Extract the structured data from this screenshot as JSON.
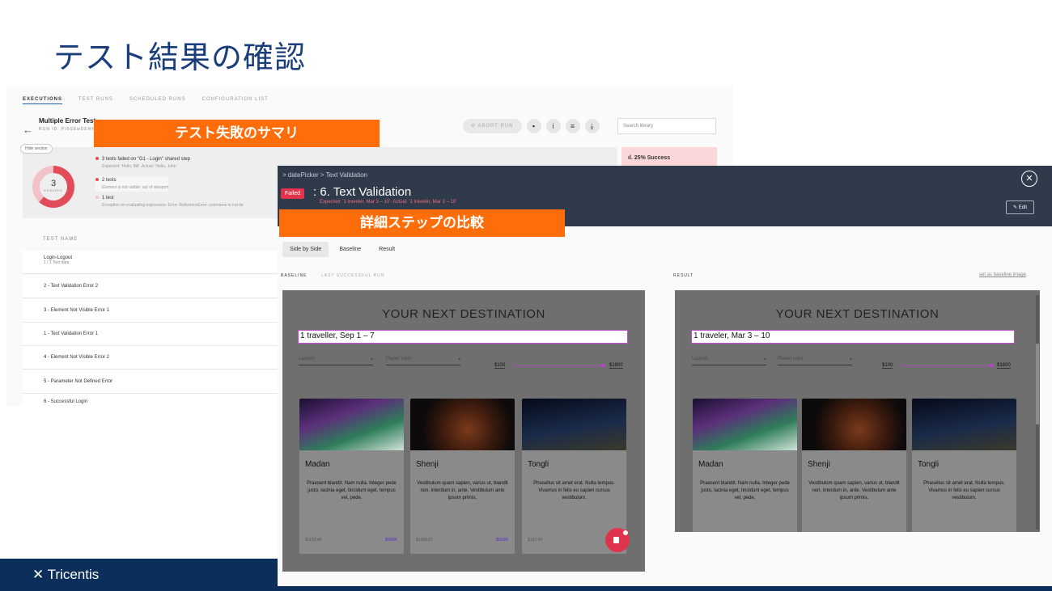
{
  "slide": {
    "title": "テスト結果の確認",
    "footer_logo": "✕ Tricentis",
    "label_summary": "テスト失敗のサマリ",
    "label_steps": "詳細ステップの比較"
  },
  "app": {
    "tabs": [
      "EXECUTIONS",
      "TEST RUNS",
      "SCHEDULED RUNS",
      "CONFIGURATION LIST"
    ],
    "run_title": "Multiple Error Test",
    "run_id": "RUN ID: PI5SEwDEHN",
    "abort_label": "ABORT RUN",
    "search_placeholder": "Search library",
    "hide_section": "Hide section",
    "errors_count": "3",
    "errors_label": "ERRORS",
    "success_text": "ıl. 25% Success",
    "failures": [
      {
        "title": "3 tests failed on \"G1 - Login\" shared step",
        "detail": "Expected: 'Hello, Bill'. Actual: 'Hello, John '"
      },
      {
        "title": "2 tests",
        "detail": "Element is not visible: out of viewport"
      },
      {
        "title": "1 test",
        "detail": "Exception on evaluating expression: Error: ReferenceError: username is not de"
      }
    ],
    "test_header": "TEST NAME",
    "tests": [
      {
        "name": "Login-Logout",
        "sub": "1 / 1 Test data"
      },
      {
        "name": "2 - Text Validation Error 2",
        "sub": ""
      },
      {
        "name": "3 - Element Not Visible Error 1",
        "sub": ""
      },
      {
        "name": "1 - Text Validation Error 1",
        "sub": ""
      },
      {
        "name": "4 - Element Not Visible Error 2",
        "sub": ""
      },
      {
        "name": "5 - Parameter Not Defined Error",
        "sub": ""
      },
      {
        "name": "6 - Successful Login",
        "sub": ""
      }
    ]
  },
  "dialog": {
    "breadcrumb": "> datePicker > Text Validation",
    "status": "Failed",
    "title": ": 6. Text Validation",
    "subtitle": "Expected: '1 traveler, Mar 3 – 10'. Actual: '1 traveler, Mar 3 – 10'",
    "edit_label": "✎ Edit",
    "view_tabs": [
      "Side by Side",
      "Baseline",
      "Result"
    ],
    "baseline_label": "BASELINE",
    "last_run_label": "LAST SUCCESSFUL RUN",
    "result_label": "RESULT",
    "set_baseline": "set as baseline image",
    "heading": "YOUR NEXT DESTINATION",
    "baseline_input": "1 traveller, Sep 1 – 7",
    "result_input": "1 traveler, Mar 3 – 10",
    "launch_label": "Launch",
    "planet_label": "Planet color",
    "price_min": "$100",
    "price_max": "$1800",
    "cards": [
      {
        "name": "Madan",
        "desc": "Praesent blandit. Nam nulla. Integer pede justo, lacinia eget, tincidunt eget, tempus vel, pede.",
        "price": "$1153.46",
        "book": "BOOK"
      },
      {
        "name": "Shenji",
        "desc": "Vestibulum quam sapien, varius ut, blandit non, interdum in, ante. Vestibulum ante ipsum primis.",
        "price": "$1289.07",
        "book": "BOOK"
      },
      {
        "name": "Tongli",
        "desc": "Phasellus sit amet erat. Nulla tempus. Vivamus in felis eu sapien cursus vestibulum.",
        "price": "$192.64",
        "book": ""
      }
    ]
  },
  "colors": {
    "accent_orange": "#ff6d0a",
    "failed_red": "#e0344c",
    "title_blue": "#1a3d7c",
    "footer_navy": "#0b2f5a"
  }
}
